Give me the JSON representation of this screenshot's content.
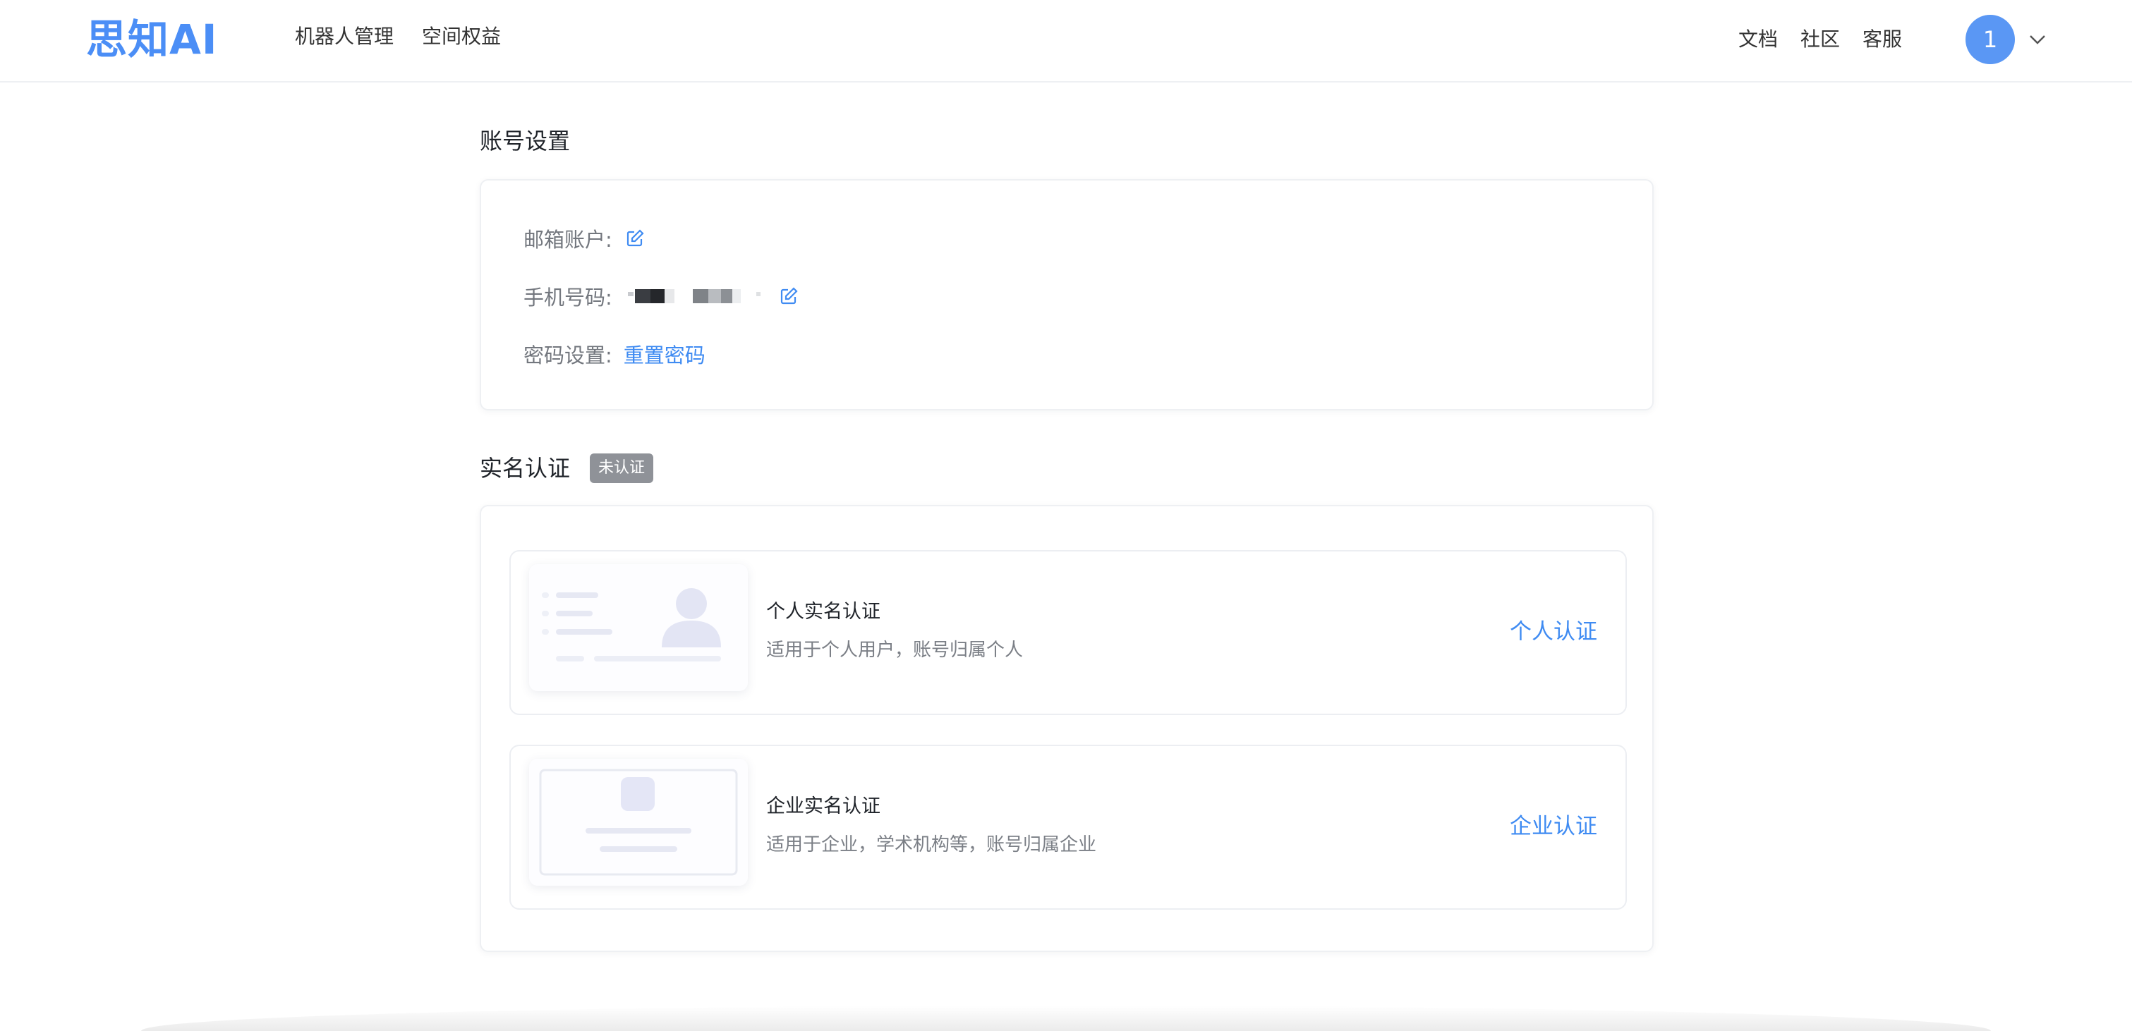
{
  "header": {
    "logo": "思知AI",
    "nav_left": [
      "机器人管理",
      "空间权益"
    ],
    "nav_right": [
      "文档",
      "社区",
      "客服"
    ],
    "avatar_text": "1",
    "accent_color": "#4b8ef6"
  },
  "account": {
    "title": "账号设置",
    "email_label": "邮箱账户:",
    "phone_label": "手机号码:",
    "password_label": "密码设置:",
    "reset_password": "重置密码"
  },
  "verification": {
    "title": "实名认证",
    "status_badge": "未认证",
    "personal": {
      "title": "个人实名认证",
      "desc": "适用于个人用户，账号归属个人",
      "action": "个人认证"
    },
    "enterprise": {
      "title": "企业实名认证",
      "desc": "适用于企业，学术机构等，账号归属企业",
      "action": "企业认证"
    }
  }
}
